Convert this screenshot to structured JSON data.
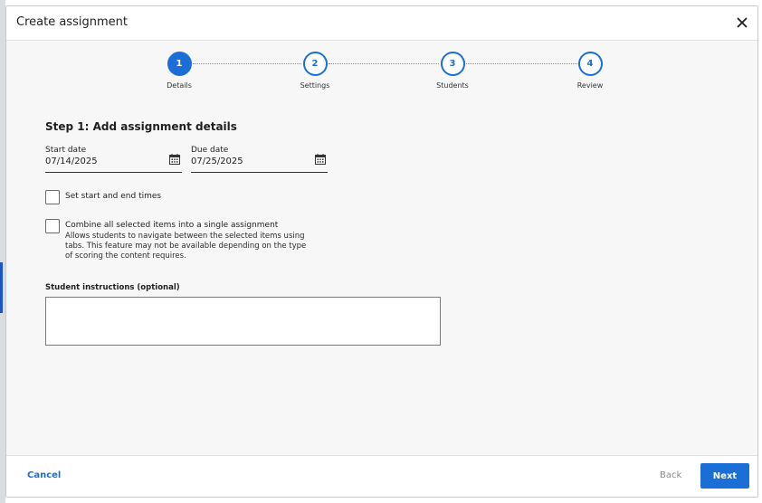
{
  "modal": {
    "title": "Create assignment"
  },
  "stepper": {
    "steps": [
      {
        "number": "1",
        "label": "Details",
        "state": "active"
      },
      {
        "number": "2",
        "label": "Settings",
        "state": "upcoming"
      },
      {
        "number": "3",
        "label": "Students",
        "state": "upcoming"
      },
      {
        "number": "4",
        "label": "Review",
        "state": "upcoming"
      }
    ]
  },
  "form": {
    "section_title": "Step 1: Add assignment details",
    "start_date": {
      "label": "Start date",
      "value": "07/14/2025"
    },
    "due_date": {
      "label": "Due date",
      "value": "07/25/2025"
    },
    "set_times": {
      "label": "Set start and end times",
      "checked": false
    },
    "combine": {
      "label": "Combine all selected items into a single assignment",
      "help_text": "Allows students to navigate between the selected items using tabs. This feature may not be available depending on the type of scoring the content requires.",
      "checked": false
    },
    "instructions": {
      "label": "Student instructions (optional)",
      "value": ""
    }
  },
  "footer": {
    "cancel_label": "Cancel",
    "back_label": "Back",
    "next_label": "Next"
  },
  "colors": {
    "accent": "#1a6fd6",
    "background": "#f7f7f7",
    "disabled_text": "#8a8a8a"
  },
  "icons": {
    "close": "close-icon",
    "calendar": "calendar-icon"
  }
}
